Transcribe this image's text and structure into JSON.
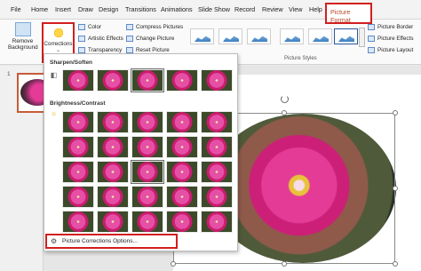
{
  "tabs": [
    "File",
    "Home",
    "Insert",
    "Draw",
    "Design",
    "Transitions",
    "Animations",
    "Slide Show",
    "Record",
    "Review",
    "View",
    "Help"
  ],
  "active_tab": "Picture Format",
  "ribbon": {
    "remove_background": "Remove Background",
    "corrections": "Corrections",
    "color": "Color",
    "artistic_effects": "Artistic Effects",
    "transparency": "Transparency",
    "compress_pictures": "Compress Pictures",
    "change_picture": "Change Picture",
    "reset_picture": "Reset Picture",
    "picture_styles_label": "Picture Styles",
    "picture_border": "Picture Border",
    "picture_effects": "Picture Effects",
    "picture_layout": "Picture Layout"
  },
  "slide_panel": {
    "slide_number": "1"
  },
  "dropdown": {
    "sharpen_title": "Sharpen/Soften",
    "brightness_title": "Brightness/Contrast",
    "options_label": "Picture Corrections Options..."
  },
  "colors": {
    "accent": "#b7472a",
    "highlight": "#d11f1f",
    "flower": "#e43b96"
  }
}
